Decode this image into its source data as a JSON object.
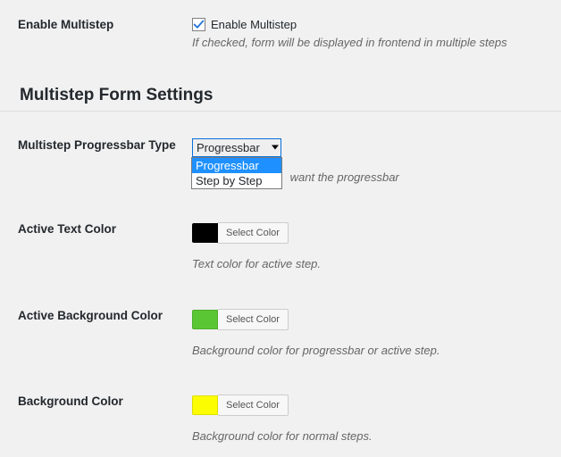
{
  "enable": {
    "row_label": "Enable Multistep",
    "checkbox_label": "Enable Multistep",
    "desc": "If checked, form will be displayed in frontend in multiple steps"
  },
  "section_title": "Multistep Form Settings",
  "progressbar": {
    "row_label": "Multistep Progressbar Type",
    "selected": "Progressbar",
    "options": [
      "Progressbar",
      "Step by Step"
    ],
    "desc_suffix": "want the progressbar"
  },
  "active_text": {
    "row_label": "Active Text Color",
    "btn": "Select Color",
    "color": "#000000",
    "desc": "Text color for active step."
  },
  "active_bg": {
    "row_label": "Active Background Color",
    "btn": "Select Color",
    "color": "#5ac634",
    "desc": "Background color for progressbar or active step."
  },
  "bg": {
    "row_label": "Background Color",
    "btn": "Select Color",
    "color": "#fdfd02",
    "desc": "Background color for normal steps."
  }
}
